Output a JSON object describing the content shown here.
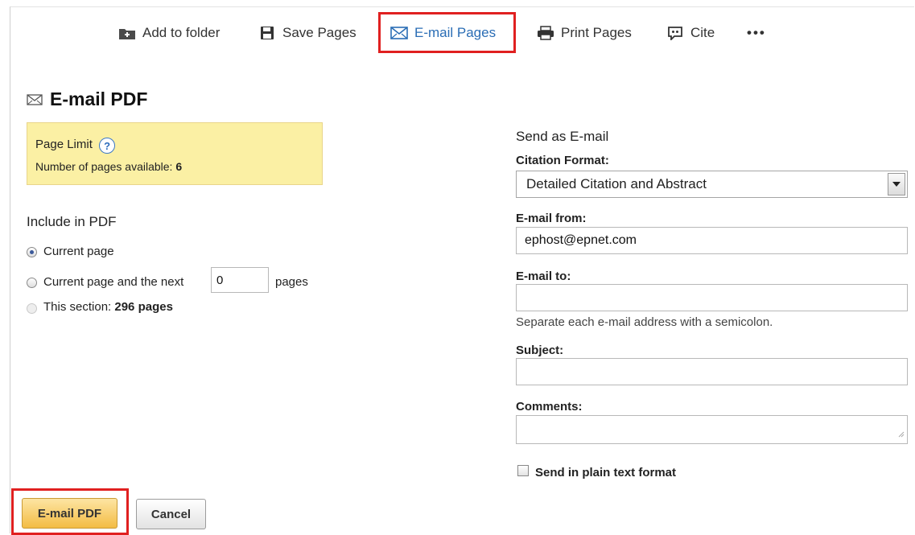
{
  "toolbar": {
    "add_to_folder": "Add to folder",
    "save_pages": "Save Pages",
    "email_pages": "E-mail Pages",
    "print_pages": "Print Pages",
    "cite": "Cite",
    "more": "•••",
    "active_color": "#2a6db5",
    "highlight_color": "#e02020"
  },
  "heading": {
    "title": "E-mail PDF",
    "icon": "envelope-icon"
  },
  "page_limit": {
    "label": "Page Limit",
    "help": "?",
    "available_label": "Number of pages available:",
    "available_value": "6",
    "background": "#fbf0a4"
  },
  "include": {
    "title": "Include in PDF",
    "current_page": "Current page",
    "current_and_next": "Current page and the next",
    "next_value": "0",
    "pages_suffix": "pages",
    "section_label": "This section:",
    "section_value": "296 pages",
    "selected": "current_page"
  },
  "email": {
    "title": "Send as E-mail",
    "citation_label": "Citation Format:",
    "citation_value": "Detailed Citation and Abstract",
    "from_label": "E-mail from:",
    "from_value": "ephost@epnet.com",
    "to_label": "E-mail to:",
    "to_value": "",
    "to_hint": "Separate each e-mail address with a semicolon.",
    "subject_label": "Subject:",
    "subject_value": "",
    "comments_label": "Comments:",
    "comments_value": "",
    "plain_text_label": "Send in plain text format",
    "plain_text_checked": false
  },
  "actions": {
    "email_pdf": "E-mail PDF",
    "cancel": "Cancel",
    "primary_color": "#f3bc44"
  }
}
